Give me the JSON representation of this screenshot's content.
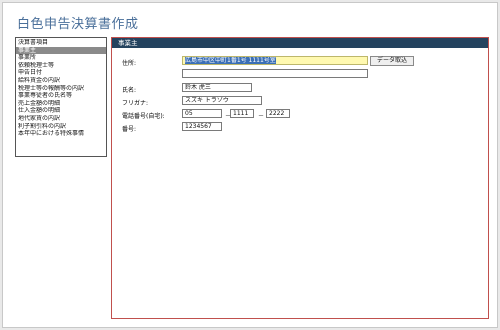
{
  "app": {
    "title": "白色申告決算書作成"
  },
  "sidebar": {
    "items": [
      {
        "label": "決算書項目"
      },
      {
        "label": "事業主"
      },
      {
        "label": "事業所"
      },
      {
        "label": "依頼税理士等"
      },
      {
        "label": "申告日付"
      },
      {
        "label": "給料賃金の内訳"
      },
      {
        "label": "税理士等の報酬等の内訳"
      },
      {
        "label": "事業専従者の氏名等"
      },
      {
        "label": "売上金額の明細"
      },
      {
        "label": "仕入金額の明細"
      },
      {
        "label": "地代家賃の内訳"
      },
      {
        "label": "利子割引料の内訳"
      },
      {
        "label": "本年中における特殊事情"
      }
    ],
    "selected_index": 1
  },
  "panel": {
    "title": "事業主",
    "address_label": "住所:",
    "address_value": "広島市中区中町1番1号 1111号室",
    "address2_value": "",
    "import_button": "データ取込",
    "name_label": "氏名:",
    "name_value": "鈴木 虎三",
    "furigana_label": "フリガナ:",
    "furigana_value": "スズキ トラゾウ",
    "phone_label": "電話番号(自宅):",
    "phone_1": "05",
    "phone_sep1": "－",
    "phone_2": "1111",
    "phone_sep2": "－",
    "phone_3": "2222",
    "number_label": "番号:",
    "number_value": "1234567"
  }
}
